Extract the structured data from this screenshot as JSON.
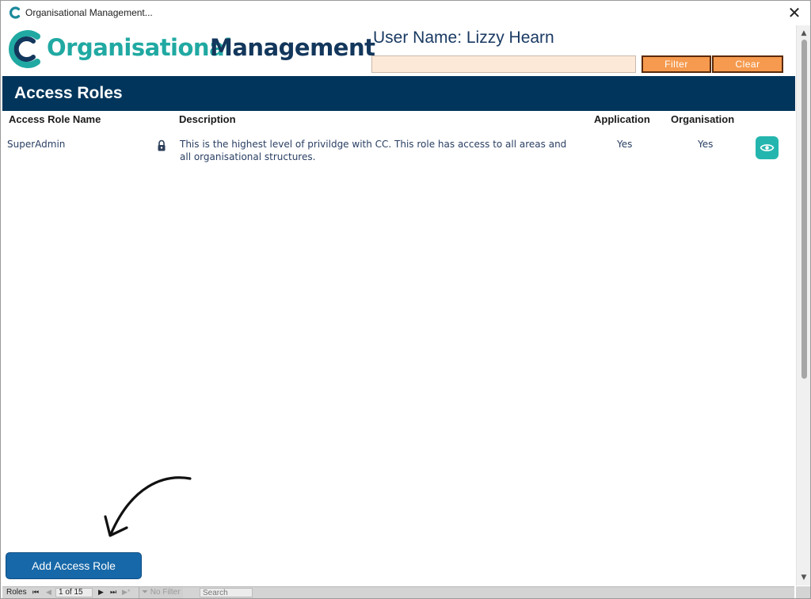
{
  "window": {
    "title": "Organisational Management...",
    "close_label": "✕"
  },
  "header": {
    "logo_word1": "Organisational",
    "logo_word2": "Management",
    "user_name": "User Name: Lizzy Hearn",
    "filter_value": "",
    "filter_button": "Filter",
    "clear_button": "Clear"
  },
  "section": {
    "title": "Access Roles"
  },
  "table": {
    "columns": [
      "Access Role Name",
      "Description",
      "Application",
      "Organisation"
    ],
    "rows": [
      {
        "name": "SuperAdmin",
        "locked": true,
        "description": "This is the highest level of privildge with CC.  This role has access to all areas and all organisational structures.",
        "application": "Yes",
        "organisation": "Yes"
      }
    ]
  },
  "actions": {
    "add_button": "Add Access Role"
  },
  "navigation": {
    "label": "Roles",
    "record": "1 of 15",
    "filter_status": "No Filter",
    "search_placeholder": "Search"
  },
  "colors": {
    "brand_teal": "#20a9a2",
    "brand_navy": "#13375c",
    "section_bar": "#01355b",
    "orange_button": "#f59a4e",
    "add_button": "#1768a8",
    "view_button": "#24b6ae"
  },
  "icons": {
    "app": "app-logo-icon",
    "lock": "lock-icon",
    "view": "eye-icon",
    "annotation": "curved-arrow-icon"
  }
}
